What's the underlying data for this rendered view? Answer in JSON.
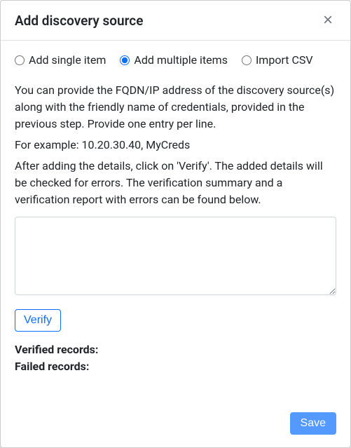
{
  "header": {
    "title": "Add discovery source",
    "close_glyph": "×"
  },
  "mode": {
    "options": [
      {
        "label": "Add single item",
        "value": "single",
        "checked": false
      },
      {
        "label": "Add multiple items",
        "value": "multiple",
        "checked": true
      },
      {
        "label": "Import CSV",
        "value": "csv",
        "checked": false
      }
    ]
  },
  "description": {
    "line1": "You can provide the FQDN/IP address of the discovery source(s) along with the friendly name of credentials, provided in the previous step. Provide one entry per line.",
    "example": "For example: 10.20.30.40, MyCreds",
    "line2": "After adding the details, click on 'Verify'. The added details will be checked for errors. The verification summary and a verification report with errors can be found below."
  },
  "entries": {
    "value": ""
  },
  "buttons": {
    "verify": "Verify",
    "save": "Save"
  },
  "status": {
    "verified_label": "Verified records:",
    "failed_label": "Failed records:"
  }
}
